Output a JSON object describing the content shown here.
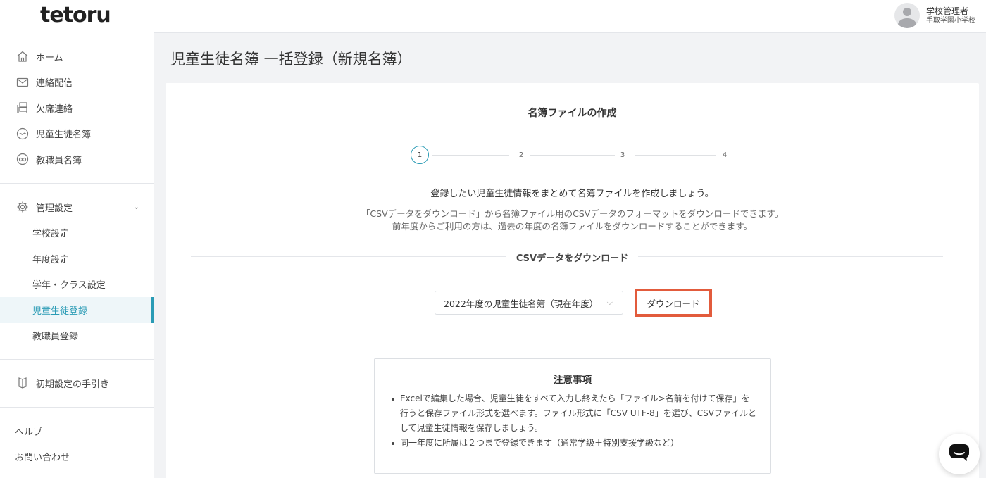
{
  "app": {
    "logo": "tetoru"
  },
  "header": {
    "user_name": "学校管理者",
    "school": "手取学園小学校"
  },
  "sidebar": {
    "main_items": [
      {
        "label": "ホーム",
        "icon": "home-icon"
      },
      {
        "label": "連絡配信",
        "icon": "mail-icon"
      },
      {
        "label": "欠席連絡",
        "icon": "desk-icon"
      },
      {
        "label": "児童生徒名簿",
        "icon": "student-icon"
      },
      {
        "label": "教職員名簿",
        "icon": "teacher-icon"
      }
    ],
    "settings": {
      "label": "管理設定",
      "icon": "gear-icon"
    },
    "settings_items": [
      {
        "label": "学校設定"
      },
      {
        "label": "年度設定"
      },
      {
        "label": "学年・クラス設定"
      },
      {
        "label": "児童生徒登録",
        "active": true
      },
      {
        "label": "教職員登録"
      }
    ],
    "guide": {
      "label": "初期設定の手引き",
      "icon": "book-icon"
    },
    "help": "ヘルプ",
    "contact": "お問い合わせ"
  },
  "page": {
    "title": "児童生徒名簿 一括登録（新規名簿）",
    "card_title": "名簿ファイルの作成",
    "steps": [
      "1",
      "2",
      "3",
      "4"
    ],
    "current_step": 1,
    "lead": "登録したい児童生徒情報をまとめて名簿ファイルを作成しましょう。",
    "desc_line1": "「CSVデータをダウンロード」から名簿ファイル用のCSVデータのフォーマットをダウンロードできます。",
    "desc_line2": "前年度からご利用の方は、過去の年度の名簿ファイルをダウンロードすることができます。",
    "section_label": "CSVデータをダウンロード",
    "select_value": "2022年度の児童生徒名簿（現在年度）",
    "download_label": "ダウンロード",
    "note": {
      "title": "注意事項",
      "items": [
        "Excelで編集した場合、児童生徒をすべて入力し終えたら「ファイル>名前を付けて保存」を行うと保存ファイル形式を選べます。ファイル形式に「CSV UTF-8」を選び、CSVファイルとして児童生徒情報を保存しましょう。",
        "同一年度に所属は２つまで登録できます（通常学級＋特別支援学級など）"
      ]
    }
  },
  "colors": {
    "accent": "#2a9bb5",
    "highlight": "#e25b3c"
  }
}
